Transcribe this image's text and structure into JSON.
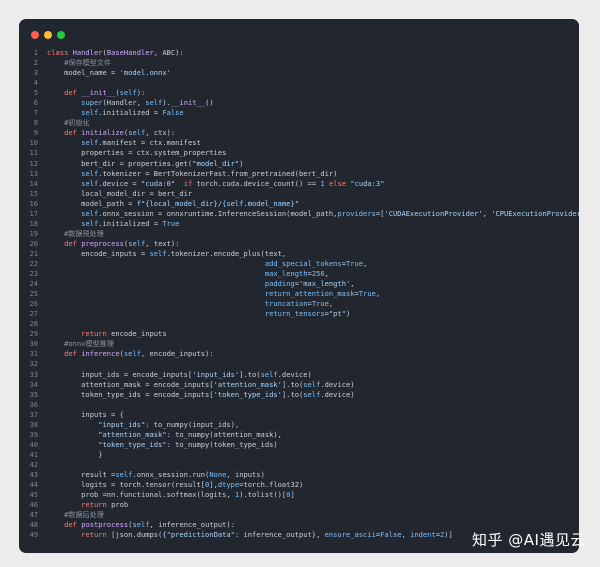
{
  "colors": {
    "keyword": "#ff7b72",
    "default": "#c9d1d9",
    "string": "#a5d6ff",
    "function": "#d2a8ff",
    "comment": "#8b949e",
    "builtin": "#79c0ff",
    "gutter": "#7d8590",
    "background": "#22262e"
  },
  "window": {
    "traffic_lights": [
      "close-icon",
      "minimize-icon",
      "maximize-icon"
    ]
  },
  "watermark": "知乎 @AI遇见云",
  "lines": [
    {
      "n": "1",
      "t": [
        [
          "kw",
          "class "
        ],
        [
          "fn",
          "Handler"
        ],
        [
          "df",
          "("
        ],
        [
          "fn",
          "BaseHandler"
        ],
        [
          "df",
          ", ABC):"
        ]
      ]
    },
    {
      "n": "2",
      "t": [
        [
          "df",
          "    "
        ],
        [
          "cm",
          "#保存模型文件"
        ]
      ]
    },
    {
      "n": "3",
      "t": [
        [
          "df",
          "    model_name = "
        ],
        [
          "st",
          "'model.onnx'"
        ]
      ]
    },
    {
      "n": "4",
      "t": []
    },
    {
      "n": "5",
      "t": [
        [
          "df",
          "    "
        ],
        [
          "kw",
          "def "
        ],
        [
          "fn",
          "__init__"
        ],
        [
          "df",
          "("
        ],
        [
          "bi",
          "self"
        ],
        [
          "df",
          "):"
        ]
      ]
    },
    {
      "n": "6",
      "t": [
        [
          "df",
          "        "
        ],
        [
          "bi",
          "super"
        ],
        [
          "df",
          "(Handler, "
        ],
        [
          "bi",
          "self"
        ],
        [
          "df",
          ")."
        ],
        [
          "fn",
          "__init__"
        ],
        [
          "df",
          "()"
        ]
      ]
    },
    {
      "n": "7",
      "t": [
        [
          "df",
          "        "
        ],
        [
          "bi",
          "self"
        ],
        [
          "df",
          ".initialized = "
        ],
        [
          "bi",
          "False"
        ]
      ]
    },
    {
      "n": "8",
      "t": [
        [
          "df",
          "    "
        ],
        [
          "cm",
          "#初始化"
        ]
      ]
    },
    {
      "n": "9",
      "t": [
        [
          "df",
          "    "
        ],
        [
          "kw",
          "def "
        ],
        [
          "fn",
          "initialize"
        ],
        [
          "df",
          "("
        ],
        [
          "bi",
          "self"
        ],
        [
          "df",
          ", ctx):"
        ]
      ]
    },
    {
      "n": "10",
      "t": [
        [
          "df",
          "        "
        ],
        [
          "bi",
          "self"
        ],
        [
          "df",
          ".manifest = ctx.manifest"
        ]
      ]
    },
    {
      "n": "11",
      "t": [
        [
          "df",
          "        properties = ctx.system_properties"
        ]
      ]
    },
    {
      "n": "12",
      "t": [
        [
          "df",
          "        bert_dir = properties.get("
        ],
        [
          "st",
          "\"model_dir\""
        ],
        [
          "df",
          ")"
        ]
      ]
    },
    {
      "n": "13",
      "t": [
        [
          "df",
          "        "
        ],
        [
          "bi",
          "self"
        ],
        [
          "df",
          ".tokenizer = BertTokenizerFast.from_pretrained(bert_dir)"
        ]
      ]
    },
    {
      "n": "14",
      "t": [
        [
          "df",
          "        "
        ],
        [
          "bi",
          "self"
        ],
        [
          "df",
          ".device = "
        ],
        [
          "st",
          "\"cuda:0\""
        ],
        [
          "df",
          "  "
        ],
        [
          "kw",
          "if"
        ],
        [
          "df",
          " torch.cuda.device_count() == "
        ],
        [
          "bi",
          "1"
        ],
        [
          "df",
          " "
        ],
        [
          "kw",
          "else"
        ],
        [
          "df",
          " "
        ],
        [
          "st",
          "\"cuda:3\""
        ]
      ]
    },
    {
      "n": "15",
      "t": [
        [
          "df",
          "        local_model_dir = bert_dir"
        ]
      ]
    },
    {
      "n": "16",
      "t": [
        [
          "df",
          "        model_path = "
        ],
        [
          "st",
          "f\"{local_model_dir}/{self.model_name}\""
        ]
      ]
    },
    {
      "n": "17",
      "t": [
        [
          "df",
          "        "
        ],
        [
          "bi",
          "self"
        ],
        [
          "df",
          ".onnx_session = onnxruntime.InferenceSession(model_path,"
        ],
        [
          "bi",
          "providers"
        ],
        [
          "df",
          "=["
        ],
        [
          "st",
          "'CUDAExecutionProvider'"
        ],
        [
          "df",
          ", "
        ],
        [
          "st",
          "'CPUExecutionProvider'"
        ],
        [
          "df",
          "])"
        ]
      ]
    },
    {
      "n": "18",
      "t": [
        [
          "df",
          "        "
        ],
        [
          "bi",
          "self"
        ],
        [
          "df",
          ".initialized = "
        ],
        [
          "bi",
          "True"
        ]
      ]
    },
    {
      "n": "19",
      "t": [
        [
          "df",
          "    "
        ],
        [
          "cm",
          "#数据预处理"
        ]
      ]
    },
    {
      "n": "20",
      "t": [
        [
          "df",
          "    "
        ],
        [
          "kw",
          "def "
        ],
        [
          "fn",
          "preprocess"
        ],
        [
          "df",
          "("
        ],
        [
          "bi",
          "self"
        ],
        [
          "df",
          ", text):"
        ]
      ]
    },
    {
      "n": "21",
      "t": [
        [
          "df",
          "        encode_inputs = "
        ],
        [
          "bi",
          "self"
        ],
        [
          "df",
          ".tokenizer.encode_plus(text,"
        ]
      ]
    },
    {
      "n": "22",
      "t": [
        [
          "df",
          "                                                   "
        ],
        [
          "bi",
          "add_special_tokens"
        ],
        [
          "df",
          "="
        ],
        [
          "bi",
          "True"
        ],
        [
          "df",
          ","
        ]
      ]
    },
    {
      "n": "23",
      "t": [
        [
          "df",
          "                                                   "
        ],
        [
          "bi",
          "max_length"
        ],
        [
          "df",
          "="
        ],
        [
          "bi",
          "256"
        ],
        [
          "df",
          ","
        ]
      ]
    },
    {
      "n": "24",
      "t": [
        [
          "df",
          "                                                   "
        ],
        [
          "bi",
          "padding"
        ],
        [
          "df",
          "="
        ],
        [
          "st",
          "'max_length'"
        ],
        [
          "df",
          ","
        ]
      ]
    },
    {
      "n": "25",
      "t": [
        [
          "df",
          "                                                   "
        ],
        [
          "bi",
          "return_attention_mask"
        ],
        [
          "df",
          "="
        ],
        [
          "bi",
          "True"
        ],
        [
          "df",
          ","
        ]
      ]
    },
    {
      "n": "26",
      "t": [
        [
          "df",
          "                                                   "
        ],
        [
          "bi",
          "truncation"
        ],
        [
          "df",
          "="
        ],
        [
          "bi",
          "True"
        ],
        [
          "df",
          ","
        ]
      ]
    },
    {
      "n": "27",
      "t": [
        [
          "df",
          "                                                   "
        ],
        [
          "bi",
          "return_tensors"
        ],
        [
          "df",
          "="
        ],
        [
          "st",
          "\"pt\""
        ],
        [
          "df",
          ")"
        ]
      ]
    },
    {
      "n": "28",
      "t": []
    },
    {
      "n": "29",
      "t": [
        [
          "df",
          "        "
        ],
        [
          "kw",
          "return"
        ],
        [
          "df",
          " encode_inputs"
        ]
      ]
    },
    {
      "n": "30",
      "t": [
        [
          "df",
          "    "
        ],
        [
          "cm",
          "#onnx模型推理"
        ]
      ]
    },
    {
      "n": "31",
      "t": [
        [
          "df",
          "    "
        ],
        [
          "kw",
          "def "
        ],
        [
          "fn",
          "inference"
        ],
        [
          "df",
          "("
        ],
        [
          "bi",
          "self"
        ],
        [
          "df",
          ", encode_inputs):"
        ]
      ]
    },
    {
      "n": "32",
      "t": []
    },
    {
      "n": "33",
      "t": [
        [
          "df",
          "        input_ids = encode_inputs["
        ],
        [
          "st",
          "'input_ids'"
        ],
        [
          "df",
          "].to("
        ],
        [
          "bi",
          "self"
        ],
        [
          "df",
          ".device)"
        ]
      ]
    },
    {
      "n": "34",
      "t": [
        [
          "df",
          "        attention_mask = encode_inputs["
        ],
        [
          "st",
          "'attention_mask'"
        ],
        [
          "df",
          "].to("
        ],
        [
          "bi",
          "self"
        ],
        [
          "df",
          ".device)"
        ]
      ]
    },
    {
      "n": "35",
      "t": [
        [
          "df",
          "        token_type_ids = encode_inputs["
        ],
        [
          "st",
          "'token_type_ids'"
        ],
        [
          "df",
          "].to("
        ],
        [
          "bi",
          "self"
        ],
        [
          "df",
          ".device)"
        ]
      ]
    },
    {
      "n": "36",
      "t": []
    },
    {
      "n": "37",
      "t": [
        [
          "df",
          "        inputs = {"
        ]
      ]
    },
    {
      "n": "38",
      "t": [
        [
          "df",
          "            "
        ],
        [
          "st",
          "\"input_ids\""
        ],
        [
          "df",
          ": to_numpy(input_ids),"
        ]
      ]
    },
    {
      "n": "39",
      "t": [
        [
          "df",
          "            "
        ],
        [
          "st",
          "\"attention_mask\""
        ],
        [
          "df",
          ": to_numpy(attention_mask),"
        ]
      ]
    },
    {
      "n": "40",
      "t": [
        [
          "df",
          "            "
        ],
        [
          "st",
          "\"token_type_ids\""
        ],
        [
          "df",
          ": to_numpy(token_type_ids)"
        ]
      ]
    },
    {
      "n": "41",
      "t": [
        [
          "df",
          "            }"
        ]
      ]
    },
    {
      "n": "42",
      "t": []
    },
    {
      "n": "43",
      "t": [
        [
          "df",
          "        result ="
        ],
        [
          "bi",
          "self"
        ],
        [
          "df",
          ".onnx_session.run("
        ],
        [
          "bi",
          "None"
        ],
        [
          "df",
          ", inputs)"
        ]
      ]
    },
    {
      "n": "44",
      "t": [
        [
          "df",
          "        logits = torch.tensor(result["
        ],
        [
          "bi",
          "0"
        ],
        [
          "df",
          "],"
        ],
        [
          "bi",
          "dtype"
        ],
        [
          "df",
          "=torch.float32)"
        ]
      ]
    },
    {
      "n": "45",
      "t": [
        [
          "df",
          "        prob =nn.functional.softmax(logits, "
        ],
        [
          "bi",
          "1"
        ],
        [
          "df",
          ").tolist()["
        ],
        [
          "bi",
          "0"
        ],
        [
          "df",
          "]"
        ]
      ]
    },
    {
      "n": "46",
      "t": [
        [
          "df",
          "        "
        ],
        [
          "kw",
          "return"
        ],
        [
          "df",
          " prob"
        ]
      ]
    },
    {
      "n": "47",
      "t": [
        [
          "df",
          "    "
        ],
        [
          "cm",
          "#数据后处理"
        ]
      ]
    },
    {
      "n": "48",
      "t": [
        [
          "df",
          "    "
        ],
        [
          "kw",
          "def "
        ],
        [
          "fn",
          "postprocess"
        ],
        [
          "df",
          "("
        ],
        [
          "bi",
          "self"
        ],
        [
          "df",
          ", inference_output):"
        ]
      ]
    },
    {
      "n": "49",
      "t": [
        [
          "df",
          "        "
        ],
        [
          "kw",
          "return"
        ],
        [
          "df",
          " [json.dumps({"
        ],
        [
          "st",
          "\"predictionData\""
        ],
        [
          "df",
          ": inference_output}, "
        ],
        [
          "bi",
          "ensure_ascii"
        ],
        [
          "df",
          "="
        ],
        [
          "bi",
          "False"
        ],
        [
          "df",
          ", "
        ],
        [
          "bi",
          "indent"
        ],
        [
          "df",
          "="
        ],
        [
          "bi",
          "2"
        ],
        [
          "df",
          ")]"
        ]
      ]
    }
  ]
}
